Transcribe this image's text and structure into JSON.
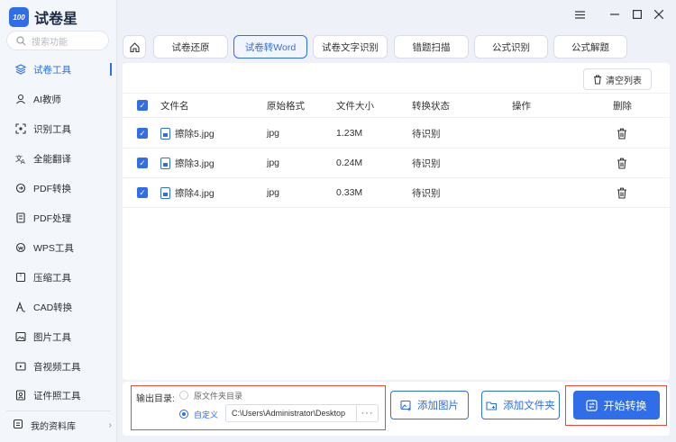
{
  "app": {
    "name": "试卷星",
    "logo_badge": "100"
  },
  "sidebar": {
    "search_placeholder": "搜索功能",
    "items": [
      {
        "label": "试卷工具",
        "icon": "layers-icon",
        "active": true
      },
      {
        "label": "AI教师",
        "icon": "ai-teacher-icon"
      },
      {
        "label": "识别工具",
        "icon": "scan-icon"
      },
      {
        "label": "全能翻译",
        "icon": "translate-icon"
      },
      {
        "label": "PDF转换",
        "icon": "pdf-convert-icon"
      },
      {
        "label": "PDF处理",
        "icon": "pdf-process-icon"
      },
      {
        "label": "WPS工具",
        "icon": "wps-icon"
      },
      {
        "label": "压缩工具",
        "icon": "compress-icon"
      },
      {
        "label": "CAD转换",
        "icon": "cad-icon"
      },
      {
        "label": "图片工具",
        "icon": "image-icon"
      },
      {
        "label": "音视频工具",
        "icon": "media-icon"
      },
      {
        "label": "证件照工具",
        "icon": "id-photo-icon"
      }
    ],
    "library_label": "我的资料库"
  },
  "tabs": [
    {
      "label": "试卷还原"
    },
    {
      "label": "试卷转Word",
      "active": true
    },
    {
      "label": "试卷文字识别"
    },
    {
      "label": "错题扫描"
    },
    {
      "label": "公式识别"
    },
    {
      "label": "公式解题"
    }
  ],
  "toolbar": {
    "clear_label": "清空列表"
  },
  "table": {
    "headers": [
      "文件名",
      "原始格式",
      "文件大小",
      "转换状态",
      "操作",
      "删除"
    ],
    "rows": [
      {
        "name": "擦除5.jpg",
        "format": "jpg",
        "size": "1.23M",
        "status": "待识别"
      },
      {
        "name": "擦除3.jpg",
        "format": "jpg",
        "size": "0.24M",
        "status": "待识别"
      },
      {
        "name": "擦除4.jpg",
        "format": "jpg",
        "size": "0.33M",
        "status": "待识别"
      }
    ]
  },
  "output": {
    "label": "输出目录:",
    "option_source": "原文件夹目录",
    "option_custom": "自定义",
    "path": "C:\\Users\\Administrator\\Desktop",
    "browse": "···"
  },
  "actions": {
    "add_image": "添加图片",
    "add_folder": "添加文件夹",
    "start": "开始转换"
  },
  "colors": {
    "accent": "#2f6ee8",
    "highlight_border": "#e64a3b"
  }
}
